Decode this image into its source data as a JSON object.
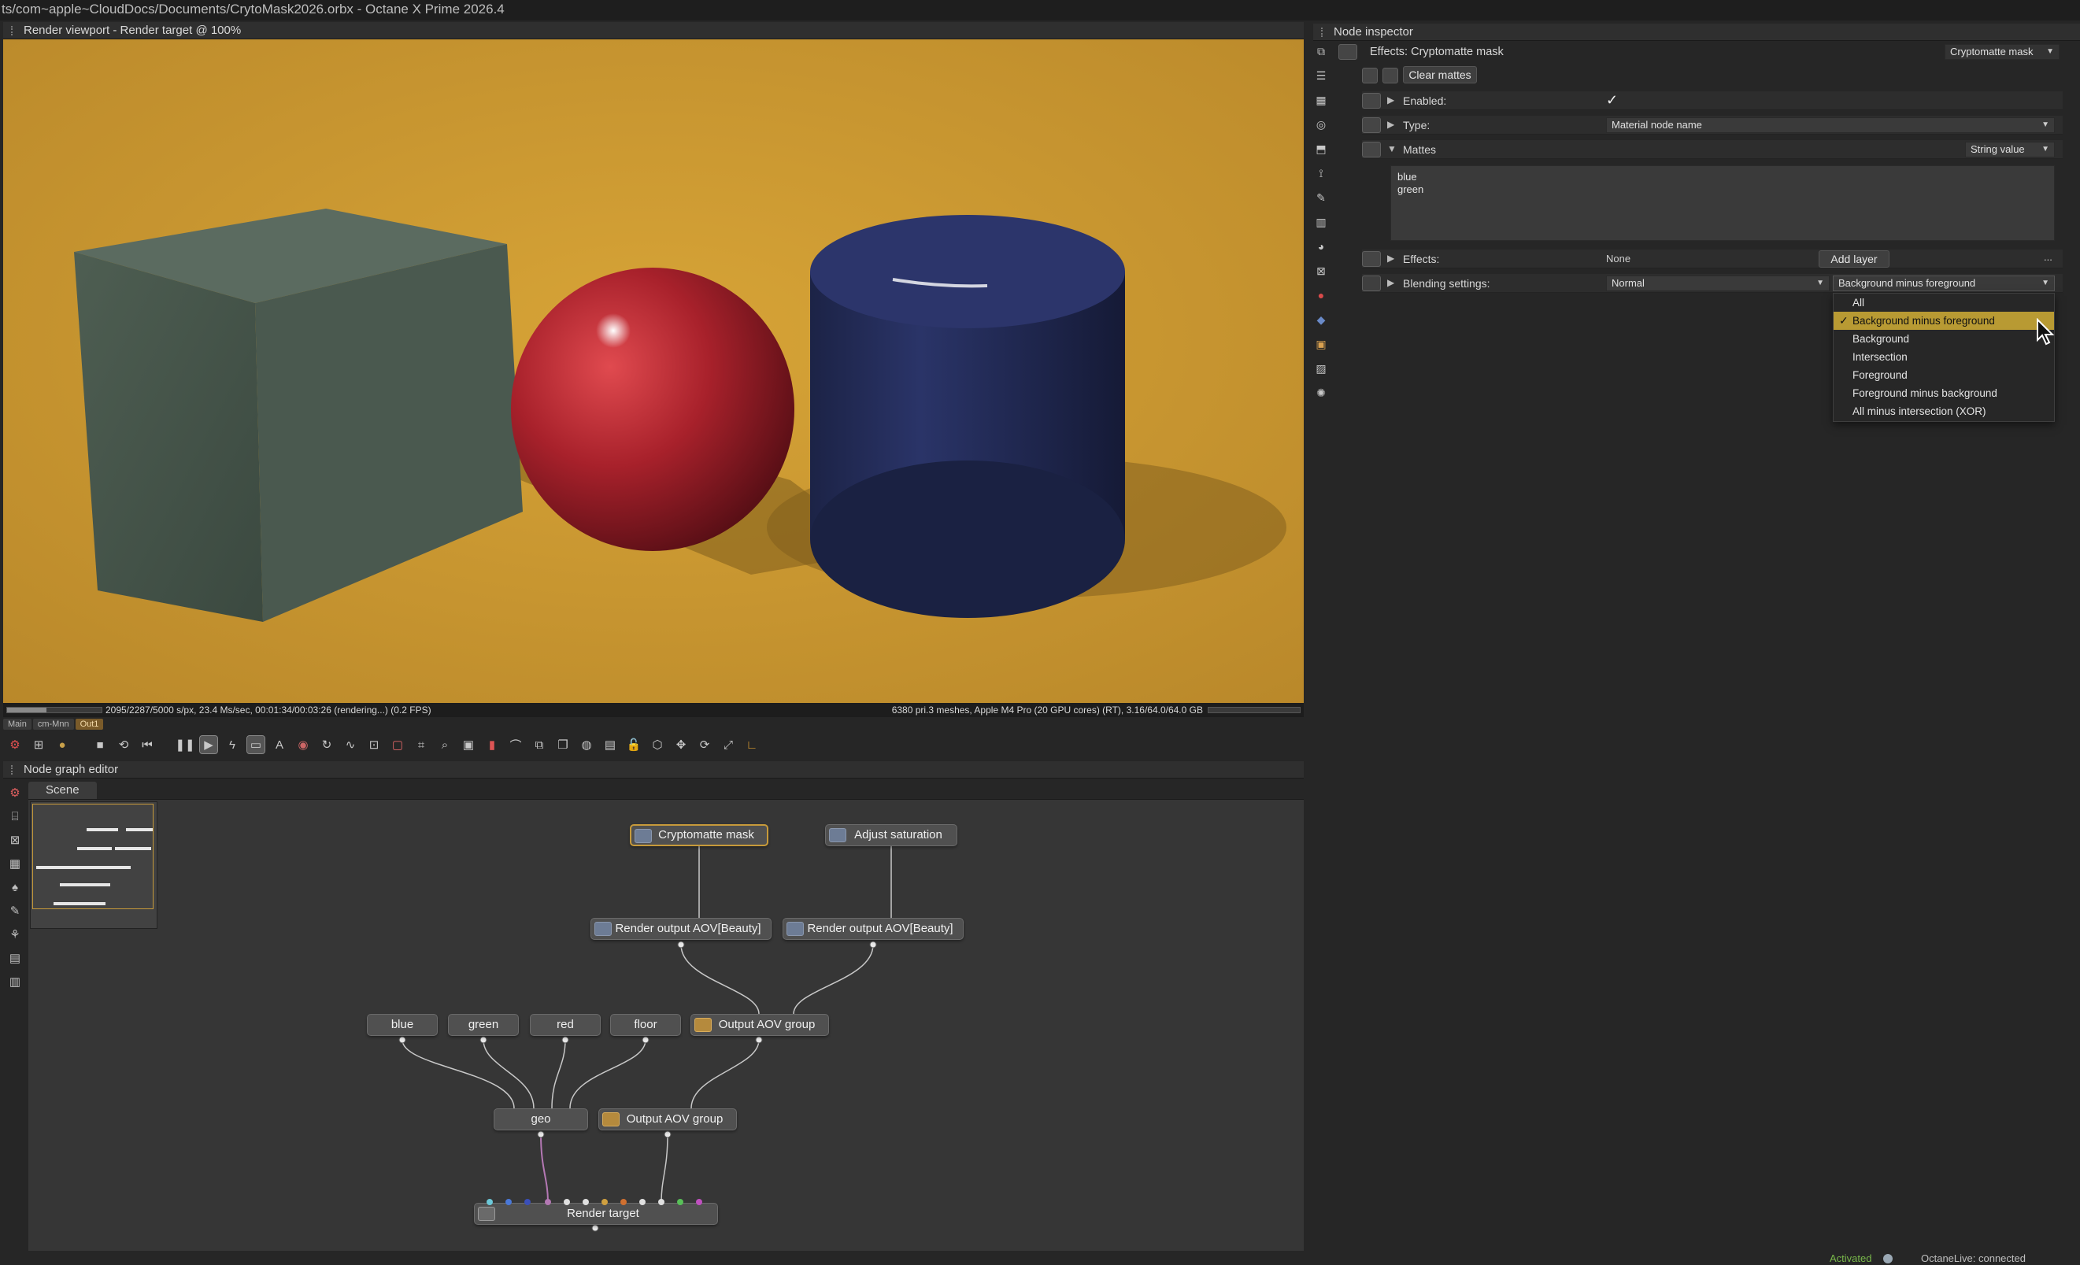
{
  "window": {
    "title": "ts/com~apple~CloudDocs/Documents/CrytoMask2026.orbx - Octane X Prime 2026.4"
  },
  "viewport": {
    "header": "Render viewport - Render target @ 100%",
    "status_left": "2095/2287/5000 s/px, 23.4 Ms/sec, 00:01:34/00:03:26 (rendering...) (0.2 FPS)",
    "status_right": "6380 pri.3 meshes, Apple M4 Pro (20 GPU cores) (RT), 3.16/64.0/64.0 GB",
    "progress_fraction": 0.42,
    "tabs": [
      "Main",
      "cm-Mnn",
      "Out1"
    ]
  },
  "node_graph": {
    "header": "Node graph editor",
    "tab": "Scene",
    "nodes": {
      "cryptomatte": "Cryptomatte mask",
      "adjust_saturation": "Adjust saturation",
      "render_output_1": "Render output AOV[Beauty]",
      "render_output_2": "Render output AOV[Beauty]",
      "blue": "blue",
      "green": "green",
      "red": "red",
      "floor": "floor",
      "output_aov_group_1": "Output AOV group",
      "geo": "geo",
      "output_aov_group_2": "Output AOV group",
      "render_target": "Render target"
    }
  },
  "inspector": {
    "header": "Node inspector",
    "effects_title": "Effects: Cryptomatte mask",
    "type_dropdown": "Cryptomatte mask",
    "clear_mattes": "Clear mattes",
    "enabled_label": "Enabled:",
    "enabled_check": "✓",
    "type_label": "Type:",
    "type_value": "Material node name",
    "mattes_label": "Mattes",
    "mattes_mode": "String value",
    "mattes_lines": [
      "blue",
      "green"
    ],
    "effects_label": "Effects:",
    "effects_value": "None",
    "add_layer": "Add layer",
    "more": "...",
    "blending_label": "Blending settings:",
    "blending_value": "Normal",
    "blending_mode_value": "Background minus foreground"
  },
  "dropdown": {
    "items": [
      "All",
      "Background minus foreground",
      "Background",
      "Intersection",
      "Foreground",
      "Foreground minus background",
      "All minus intersection (XOR)"
    ],
    "selected_index": 1,
    "check": "✓"
  },
  "status_bar": {
    "activated": "Activated",
    "octanelive": "OctaneLive:   connected"
  },
  "colors": {
    "background_gold": "#c9962e",
    "selection_gold": "#b89a33",
    "activated_green": "#78b84a"
  }
}
